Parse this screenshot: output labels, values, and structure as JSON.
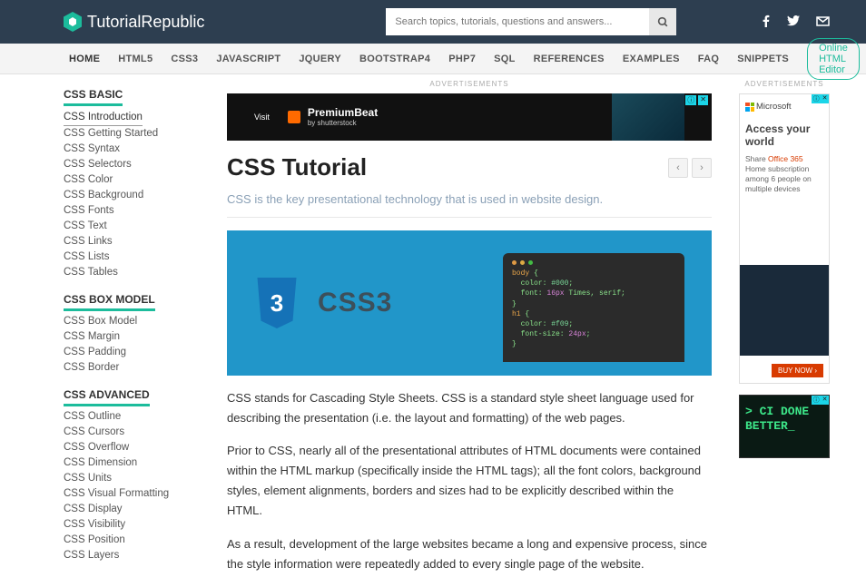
{
  "header": {
    "logo_text": "TutorialRepublic",
    "search_placeholder": "Search topics, tutorials, questions and answers..."
  },
  "nav": {
    "items": [
      "HOME",
      "HTML5",
      "CSS3",
      "JAVASCRIPT",
      "JQUERY",
      "BOOTSTRAP4",
      "PHP7",
      "SQL",
      "REFERENCES",
      "EXAMPLES",
      "FAQ",
      "SNIPPETS"
    ],
    "editor_btn": "Online HTML Editor"
  },
  "sidebar": {
    "sections": [
      {
        "title": "CSS BASIC",
        "items": [
          "CSS Introduction",
          "CSS Getting Started",
          "CSS Syntax",
          "CSS Selectors",
          "CSS Color",
          "CSS Background",
          "CSS Fonts",
          "CSS Text",
          "CSS Links",
          "CSS Lists",
          "CSS Tables"
        ],
        "active_index": 0
      },
      {
        "title": "CSS BOX MODEL",
        "items": [
          "CSS Box Model",
          "CSS Margin",
          "CSS Padding",
          "CSS Border"
        ]
      },
      {
        "title": "CSS ADVANCED",
        "items": [
          "CSS Outline",
          "CSS Cursors",
          "CSS Overflow",
          "CSS Dimension",
          "CSS Units",
          "CSS Visual Formatting",
          "CSS Display",
          "CSS Visibility",
          "CSS Position",
          "CSS Layers"
        ]
      }
    ]
  },
  "main": {
    "ads_label": "ADVERTISEMENTS",
    "ad_banner": {
      "visit": "Visit",
      "brand": "PremiumBeat",
      "sub": "by shutterstock"
    },
    "title": "CSS Tutorial",
    "lead": "CSS is the key presentational technology that is used in website design.",
    "hero_label": "CSS3",
    "code": "body {\n  color: #000;\n  font: 16px Times, serif;\n}\nh1 {\n  color: #f09;\n  font-size: 24px;\n}",
    "paragraphs": [
      "CSS stands for Cascading Style Sheets. CSS is a standard style sheet language used for describing the presentation (i.e. the layout and formatting) of the web pages.",
      "Prior to CSS, nearly all of the presentational attributes of HTML documents were contained within the HTML markup (specifically inside the HTML tags); all the font colors, background styles, element alignments, borders and sizes had to be explicitly described within the HTML.",
      "As a result, development of the large websites became a long and expensive process, since the style information were repeatedly added to every single page of the website."
    ]
  },
  "right": {
    "ads_label": "ADVERTISEMENTS",
    "ad1": {
      "brand": "Microsoft",
      "title": "Access your world",
      "share": "Share ",
      "product": "Office 365",
      "sub": " Home subscription among 6 people on multiple devices",
      "cta": "BUY NOW ›"
    },
    "ad2": {
      "line1": "> CI DONE",
      "line2": "  BETTER_"
    }
  }
}
